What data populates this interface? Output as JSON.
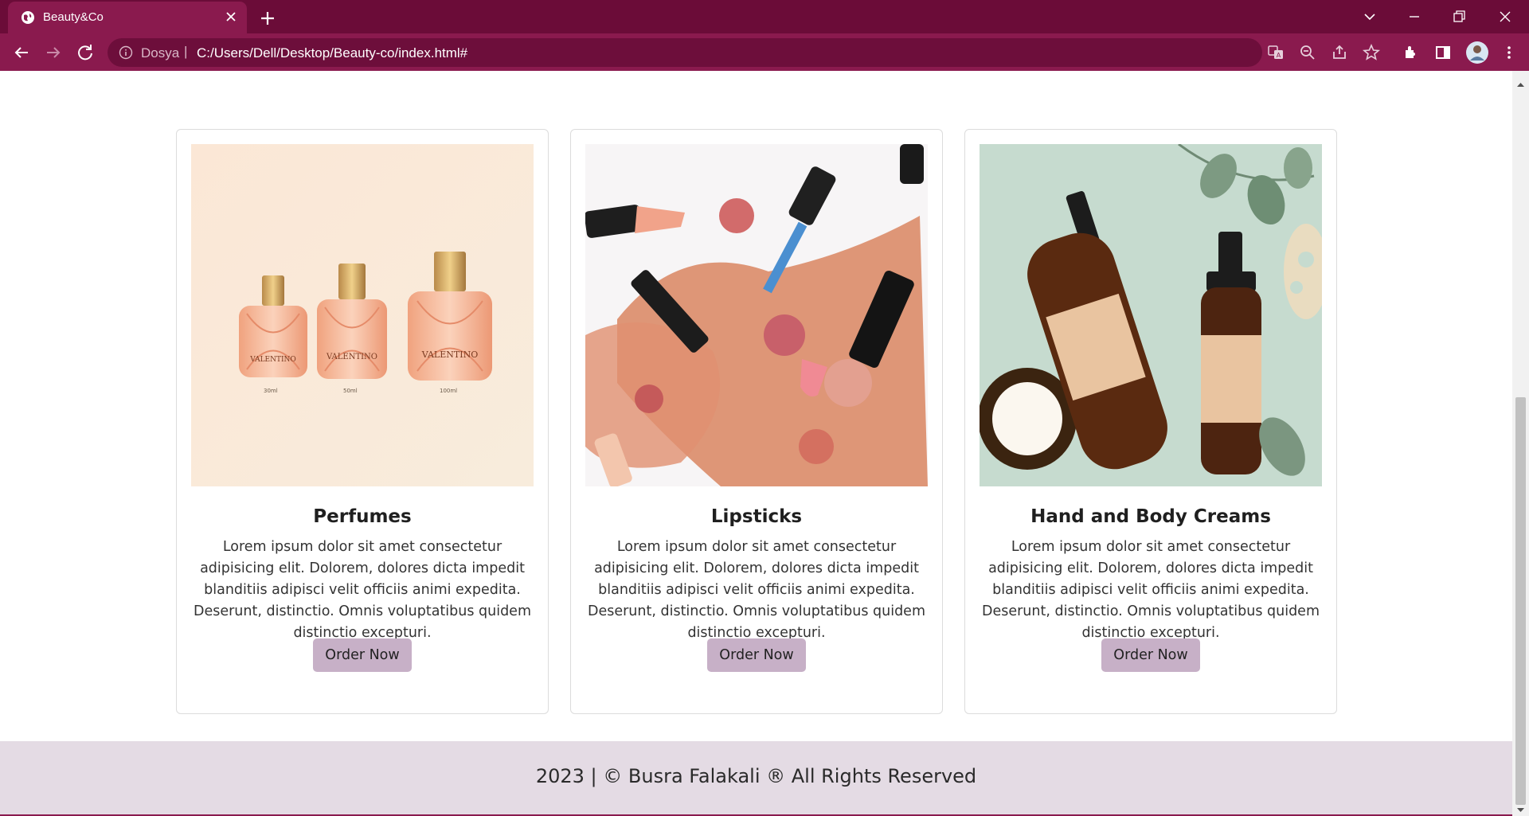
{
  "browser": {
    "tab_title": "Beauty&Co",
    "address_scheme_label": "Dosya",
    "address_separator": "|",
    "address_url": "C:/Users/Dell/Desktop/Beauty-co/index.html#"
  },
  "colors": {
    "chrome_dark": "#6b0c38",
    "chrome": "#8a1a4e",
    "button_bg": "#c7b0c7",
    "footer_bg": "#e4dbe4"
  },
  "products": [
    {
      "title": "Perfumes",
      "description": "Lorem ipsum dolor sit amet consectetur adipisicing elit. Dolorem, dolores dicta impedit blanditiis adipisci velit officiis animi expedita. Deserunt, distinctio. Omnis voluptatibus quidem distinctio excepturi.",
      "button": "Order Now",
      "image": "perfume-bottles-image",
      "bottle_labels": [
        "VALENTINO",
        "VALENTINO",
        "VALENTINO"
      ],
      "bottle_sizes": [
        "30ml",
        "50ml",
        "100ml"
      ]
    },
    {
      "title": "Lipsticks",
      "description": "Lorem ipsum dolor sit amet consectetur adipisicing elit. Dolorem, dolores dicta impedit blanditiis adipisci velit officiis animi expedita. Deserunt, distinctio. Omnis voluptatibus quidem distinctio excepturi.",
      "button": "Order Now",
      "image": "lipsticks-powder-image"
    },
    {
      "title": "Hand and Body Creams",
      "description": "Lorem ipsum dolor sit amet consectetur adipisicing elit. Dolorem, dolores dicta impedit blanditiis adipisci velit officiis animi expedita. Deserunt, distinctio. Omnis voluptatibus quidem distinctio excepturi.",
      "button": "Order Now",
      "image": "cream-bottles-image"
    }
  ],
  "footer": {
    "text": "2023 | © Busra Falakali ® All Rights Reserved"
  }
}
